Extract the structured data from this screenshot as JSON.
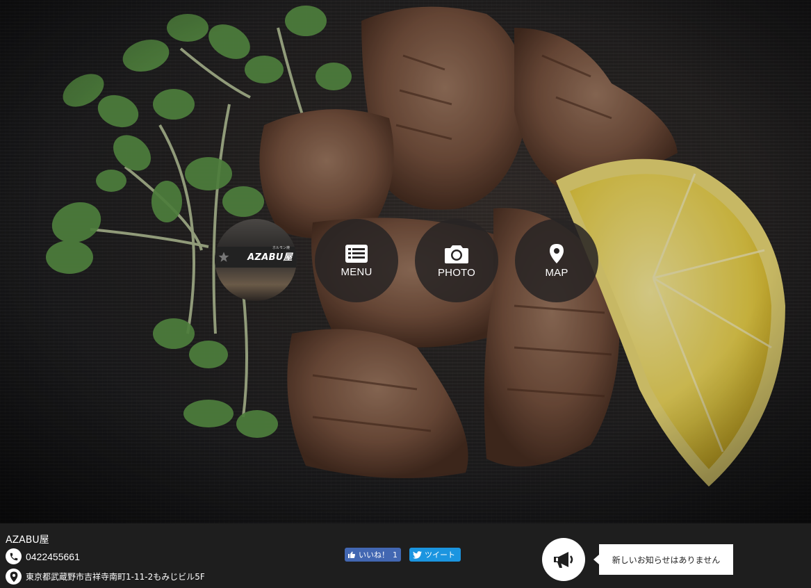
{
  "hero": {
    "logo": {
      "text": "AZABU屋",
      "subtext": "ホルモン焼"
    },
    "nav": [
      {
        "label": "MENU",
        "icon": "menu-list-icon"
      },
      {
        "label": "PHOTO",
        "icon": "camera-icon"
      },
      {
        "label": "MAP",
        "icon": "map-pin-icon"
      }
    ]
  },
  "footer": {
    "shop_name": "AZABU屋",
    "phone": "0422455661",
    "address": "東京都武蔵野市吉祥寺南町1-11-2もみじビル5F",
    "facebook": {
      "label": "いいね！",
      "count": "1"
    },
    "twitter": {
      "label": "ツイート"
    },
    "news": {
      "message": "新しいお知らせはありません",
      "icon": "megaphone-icon"
    }
  },
  "colors": {
    "overlay_circle": "#282424",
    "footer_bg": "#1e1e1e",
    "facebook": "#4267b2",
    "twitter": "#1b95e0"
  }
}
